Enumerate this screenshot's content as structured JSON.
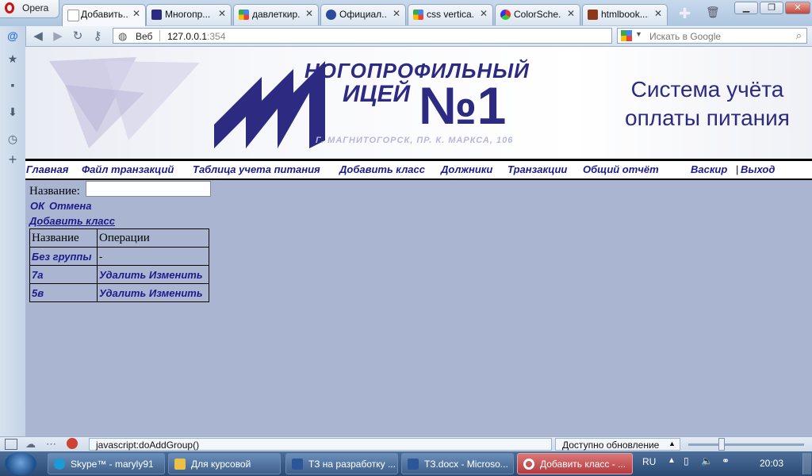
{
  "browser": {
    "menu_button": "Opera",
    "tabs": [
      {
        "label": "Добавить..."
      },
      {
        "label": "Многопр..."
      },
      {
        "label": "давлеткир..."
      },
      {
        "label": "Официал..."
      },
      {
        "label": "css vertica..."
      },
      {
        "label": "ColorSche..."
      },
      {
        "label": "htmlbook...."
      }
    ],
    "address_prefix": "Веб",
    "address_host": "127.0.0.1",
    "address_port": ":354",
    "search_placeholder": "Искать в Google"
  },
  "header": {
    "system_title": "Система учёта оплаты питания",
    "school_line1": "НОГОПРОФИЛЬНЫЙ",
    "school_line2": "ИЦЕЙ",
    "school_number": "№1",
    "school_address": "Г. МАГНИТОГОРСК, ПР. К. МАРКСА, 106"
  },
  "menu": [
    "Главная",
    "Файл транзакций",
    "Таблица учета питания",
    "Добавить класс",
    "Должники",
    "Транзакции",
    "Общий отчёт"
  ],
  "menu_right": {
    "backup": "Васкир",
    "separator": "|",
    "logout": "Выход"
  },
  "form": {
    "name_label": "Название:",
    "name_value": "",
    "ok": "ОК",
    "cancel": "Отмена",
    "add_class": "Добавить класс"
  },
  "table": {
    "headers": [
      "Название",
      "Операции"
    ],
    "rows": [
      {
        "name": "Без группы",
        "ops": "-",
        "delete": "",
        "edit": ""
      },
      {
        "name": "7а",
        "ops": "",
        "delete": "Удалить",
        "edit": "Изменить"
      },
      {
        "name": "5в",
        "ops": "",
        "delete": "Удалить",
        "edit": "Изменить"
      }
    ]
  },
  "statusbar": {
    "url": "javascript:doAddGroup()",
    "update": "Доступно обновление"
  },
  "taskbar": {
    "items": [
      {
        "label": "Skype™ - maryly91"
      },
      {
        "label": "Для курсовой"
      },
      {
        "label": "ТЗ на разработку ..."
      },
      {
        "label": "ТЗ.docx - Microso..."
      },
      {
        "label": "Добавить класс - ..."
      }
    ],
    "lang": "RU",
    "time": "20:03"
  },
  "colors": {
    "page_bg": "#aab5d2",
    "link": "#1b1b8a",
    "brand": "#2d2a82"
  }
}
